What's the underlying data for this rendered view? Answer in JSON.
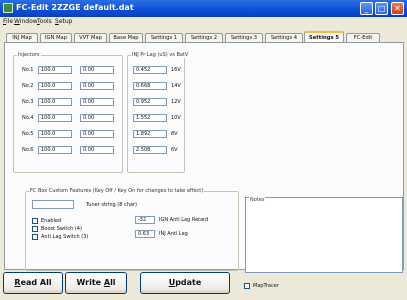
{
  "window": {
    "title": "FC-Edit 2ZZGE  default.dat",
    "minimize": "_",
    "maximize": "□",
    "close": "✕"
  },
  "menu": [
    {
      "label": "File",
      "accel": "F",
      "rest": "ile"
    },
    {
      "label": "Window",
      "accel": "W",
      "rest": "indow"
    },
    {
      "label": "Tools",
      "accel": "T",
      "rest": "ools"
    },
    {
      "label": "Setup",
      "accel": "S",
      "rest": "etup"
    }
  ],
  "tabs": [
    "INJ Map",
    "IGN Map",
    "VVT Map",
    "Base Map",
    "Settings 1",
    "Settings 2",
    "Settings 3",
    "Settings 4",
    "Settings 5",
    "FC-Edit"
  ],
  "active_tab": "Settings 5",
  "injectors": {
    "title": "Injectors",
    "rows": [
      {
        "label": "No.1",
        "a": "100.0",
        "b": "0.00"
      },
      {
        "label": "No.2",
        "a": "100.0",
        "b": "0.00"
      },
      {
        "label": "No.3",
        "a": "100.0",
        "b": "0.00"
      },
      {
        "label": "No.4",
        "a": "100.0",
        "b": "0.00"
      },
      {
        "label": "No.5",
        "a": "100.0",
        "b": "0.00"
      },
      {
        "label": "No.6",
        "a": "100.0",
        "b": "0.00"
      }
    ]
  },
  "inj_lag": {
    "title": "INJ Pr Lag (uS) vs BatV",
    "rows": [
      {
        "value": "0.452",
        "volt": "16V"
      },
      {
        "value": "0.668",
        "volt": "14V"
      },
      {
        "value": "0.952",
        "volt": "12V"
      },
      {
        "value": "1.552",
        "volt": "10V"
      },
      {
        "value": "1.892",
        "volt": "8V"
      },
      {
        "value": "2.508",
        "volt": "6V"
      }
    ]
  },
  "custom": {
    "title": "FC Box Custom Features (Key Off / Key On for changes to take effect)",
    "tuner_label": "Tuner string (8 char)",
    "tuner_value": "",
    "checks": [
      {
        "label": "Enabled",
        "checked": false
      },
      {
        "label": "Boost Switch (4)",
        "checked": false
      },
      {
        "label": "Anti Lag Switch (3)",
        "checked": false
      }
    ],
    "ign_retard_value": "-32",
    "ign_retard_label": "IGN Anti Lag Retard",
    "inj_anti_value": "0.63",
    "inj_anti_label": "INJ Anti Lag"
  },
  "notes": {
    "title": "Notes",
    "text": ""
  },
  "bottom": {
    "read_all": "Read All",
    "read_accel": "R",
    "read_rest": "ead All",
    "write_all": "Write All",
    "write_main": "Write ",
    "write_accel": "A",
    "write_rest": "ll",
    "update": "Update",
    "update_accel": "U",
    "update_rest": "pdate",
    "map_tracer": "MapTracer",
    "map_tracer_checked": false
  }
}
